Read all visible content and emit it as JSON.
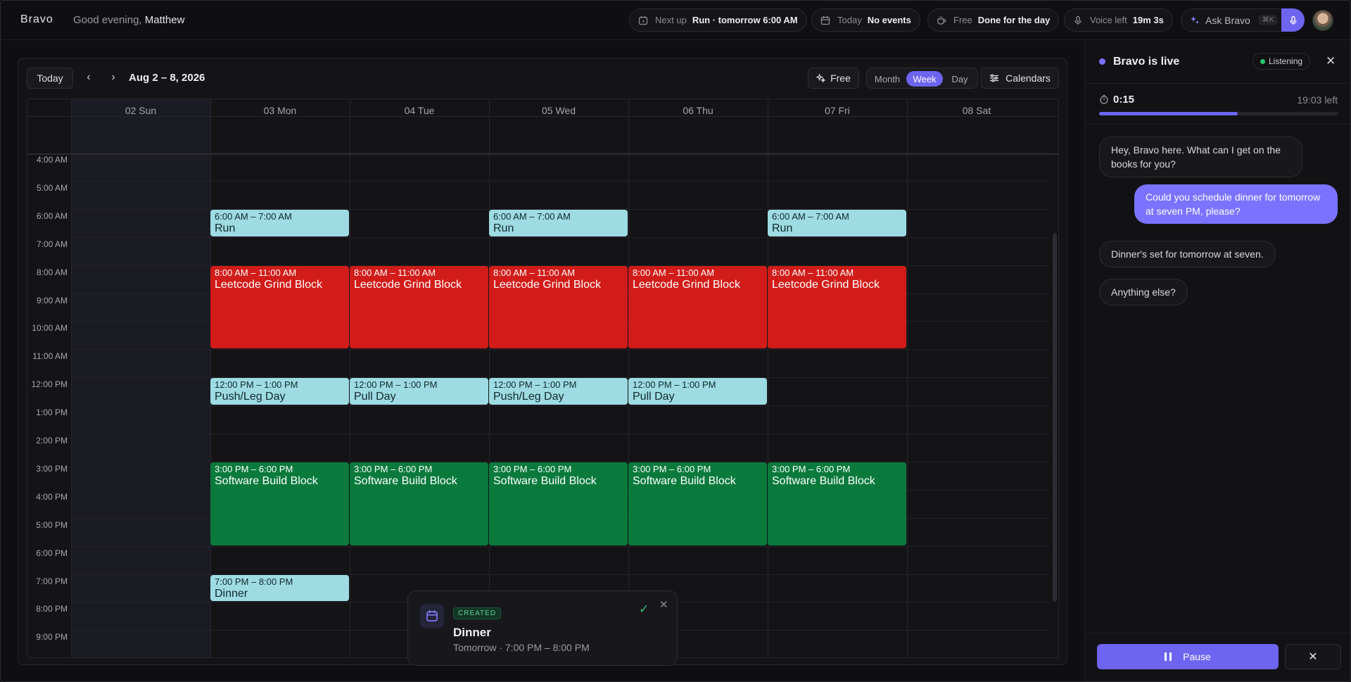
{
  "app": {
    "logo": "Bravo",
    "greeting_prefix": "Good evening,",
    "user_name": "Matthew"
  },
  "status_pills": {
    "next_up": {
      "label": "Next up",
      "value": "Run · tomorrow 6:00 AM"
    },
    "today": {
      "label": "Today",
      "value": "No events"
    },
    "free": {
      "label": "Free",
      "value": "Done for the day"
    },
    "voice": {
      "label": "Voice left",
      "value": "19m 3s"
    }
  },
  "ask": {
    "label": "Ask Bravo",
    "shortcut": "⌘K"
  },
  "toolbar": {
    "today_label": "Today",
    "range": "Aug 2 – 8, 2026",
    "free_label": "Free",
    "views": [
      "Month",
      "Week",
      "Day"
    ],
    "active_view": "Week",
    "calendars_label": "Calendars"
  },
  "days": [
    "02 Sun",
    "03 Mon",
    "04 Tue",
    "05 Wed",
    "06 Thu",
    "07 Fri",
    "08 Sat"
  ],
  "hours": [
    "4:00 AM",
    "5:00 AM",
    "6:00 AM",
    "7:00 AM",
    "8:00 AM",
    "9:00 AM",
    "10:00 AM",
    "11:00 AM",
    "12:00 PM",
    "1:00 PM",
    "2:00 PM",
    "3:00 PM",
    "4:00 PM",
    "5:00 PM",
    "6:00 PM",
    "7:00 PM",
    "8:00 PM",
    "9:00 PM"
  ],
  "colors": {
    "accent": "#6d64f0",
    "teal": "#9edbe3",
    "red": "#d11c19",
    "green": "#0a7a3c"
  },
  "events": [
    {
      "day": 1,
      "start": 6,
      "end": 7,
      "time": "6:00 AM – 7:00 AM",
      "title": "Run",
      "color": "teal"
    },
    {
      "day": 3,
      "start": 6,
      "end": 7,
      "time": "6:00 AM – 7:00 AM",
      "title": "Run",
      "color": "teal"
    },
    {
      "day": 5,
      "start": 6,
      "end": 7,
      "time": "6:00 AM – 7:00 AM",
      "title": "Run",
      "color": "teal"
    },
    {
      "day": 1,
      "start": 8,
      "end": 11,
      "time": "8:00 AM – 11:00 AM",
      "title": "Leetcode Grind Block",
      "color": "red"
    },
    {
      "day": 2,
      "start": 8,
      "end": 11,
      "time": "8:00 AM – 11:00 AM",
      "title": "Leetcode Grind Block",
      "color": "red"
    },
    {
      "day": 3,
      "start": 8,
      "end": 11,
      "time": "8:00 AM – 11:00 AM",
      "title": "Leetcode Grind Block",
      "color": "red"
    },
    {
      "day": 4,
      "start": 8,
      "end": 11,
      "time": "8:00 AM – 11:00 AM",
      "title": "Leetcode Grind Block",
      "color": "red"
    },
    {
      "day": 5,
      "start": 8,
      "end": 11,
      "time": "8:00 AM – 11:00 AM",
      "title": "Leetcode Grind Block",
      "color": "red"
    },
    {
      "day": 1,
      "start": 12,
      "end": 13,
      "time": "12:00 PM – 1:00 PM",
      "title": "Push/Leg Day",
      "color": "teal"
    },
    {
      "day": 2,
      "start": 12,
      "end": 13,
      "time": "12:00 PM – 1:00 PM",
      "title": "Pull Day",
      "color": "teal"
    },
    {
      "day": 3,
      "start": 12,
      "end": 13,
      "time": "12:00 PM – 1:00 PM",
      "title": "Push/Leg Day",
      "color": "teal"
    },
    {
      "day": 4,
      "start": 12,
      "end": 13,
      "time": "12:00 PM – 1:00 PM",
      "title": "Pull Day",
      "color": "teal"
    },
    {
      "day": 1,
      "start": 15,
      "end": 18,
      "time": "3:00 PM – 6:00 PM",
      "title": "Software Build Block",
      "color": "green"
    },
    {
      "day": 2,
      "start": 15,
      "end": 18,
      "time": "3:00 PM – 6:00 PM",
      "title": "Software Build Block",
      "color": "green"
    },
    {
      "day": 3,
      "start": 15,
      "end": 18,
      "time": "3:00 PM – 6:00 PM",
      "title": "Software Build Block",
      "color": "green"
    },
    {
      "day": 4,
      "start": 15,
      "end": 18,
      "time": "3:00 PM – 6:00 PM",
      "title": "Software Build Block",
      "color": "green"
    },
    {
      "day": 5,
      "start": 15,
      "end": 18,
      "time": "3:00 PM – 6:00 PM",
      "title": "Software Build Block",
      "color": "green"
    },
    {
      "day": 1,
      "start": 19,
      "end": 20,
      "time": "7:00 PM – 8:00 PM",
      "title": "Dinner",
      "color": "teal"
    }
  ],
  "toast": {
    "badge": "CREATED",
    "title": "Dinner",
    "subtitle": "Tomorrow · 7:00 PM – 8:00 PM"
  },
  "assistant": {
    "title": "Bravo is live",
    "status": "Listening",
    "elapsed": "0:15",
    "remaining": "19:03 left",
    "progress": 0.58,
    "messages": [
      {
        "from": "bot",
        "text": "Hey, Bravo here. What can I get on the books for you?"
      },
      {
        "from": "me",
        "text": "Could you schedule dinner for tomorrow at seven PM, please?"
      },
      {
        "from": "bot",
        "text": "Dinner's set for tomorrow at seven."
      },
      {
        "from": "bot",
        "text": "Anything else?"
      }
    ],
    "pause_label": "Pause"
  }
}
